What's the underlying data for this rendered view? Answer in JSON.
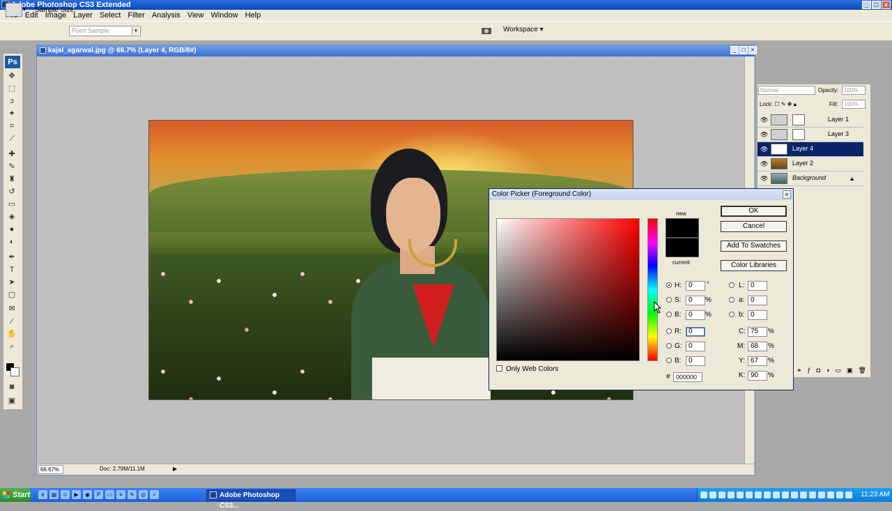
{
  "app": {
    "title": "Adobe Photoshop CS3 Extended",
    "window_buttons": [
      "_",
      "□",
      "×"
    ]
  },
  "menu": [
    "File",
    "Edit",
    "Image",
    "Layer",
    "Select",
    "Filter",
    "Analysis",
    "View",
    "Window",
    "Help"
  ],
  "options_bar": {
    "sample_size_label": "Sample Size:",
    "sample_size_value": "Point Sample",
    "workspace_label": "Workspace"
  },
  "document": {
    "title": "kajal_agarwal.jpg @ 66.7% (Layer 4, RGB/8#)",
    "zoom": "66.67%",
    "doc_info": "Doc: 2.79M/11.1M"
  },
  "layers_panel": {
    "blend_mode": "Normal",
    "opacity_label": "Opacity:",
    "opacity_value": "100%",
    "lock_label": "Lock:",
    "fill_label": "Fill:",
    "fill_value": "100%",
    "layers": [
      {
        "name": "Layer 1",
        "selected": false
      },
      {
        "name": "Layer 3",
        "selected": false
      },
      {
        "name": "Layer 4",
        "selected": true
      },
      {
        "name": "Layer 2",
        "selected": false
      },
      {
        "name": "Background",
        "selected": false
      }
    ]
  },
  "color_picker": {
    "title": "Color Picker (Foreground Color)",
    "new_label": "new",
    "current_label": "current",
    "ok": "OK",
    "cancel": "Cancel",
    "add_to_swatches": "Add To Swatches",
    "color_libraries": "Color Libraries",
    "only_web_colors": "Only Web Colors",
    "hex": "000000",
    "fields": {
      "H": "0",
      "S": "0",
      "B": "0",
      "R": "0",
      "G": "0",
      "B2": "0",
      "L": "0",
      "a": "0",
      "b": "0",
      "C": "75",
      "M": "68",
      "Y": "67",
      "K": "90"
    },
    "labels": {
      "H": "H:",
      "S": "S:",
      "B": "B:",
      "R": "R:",
      "G": "G:",
      "B2": "B:",
      "L": "L:",
      "a": "a:",
      "b": "b:",
      "C": "C:",
      "M": "M:",
      "Y": "Y:",
      "K": "K:",
      "deg": "°",
      "pct": "%",
      "hash": "#"
    },
    "colors": {
      "new": "#000000",
      "current": "#000000"
    }
  },
  "taskbar": {
    "start": "Start",
    "active_task": "Adobe Photoshop CS3...",
    "clock": "11:23 AM"
  }
}
